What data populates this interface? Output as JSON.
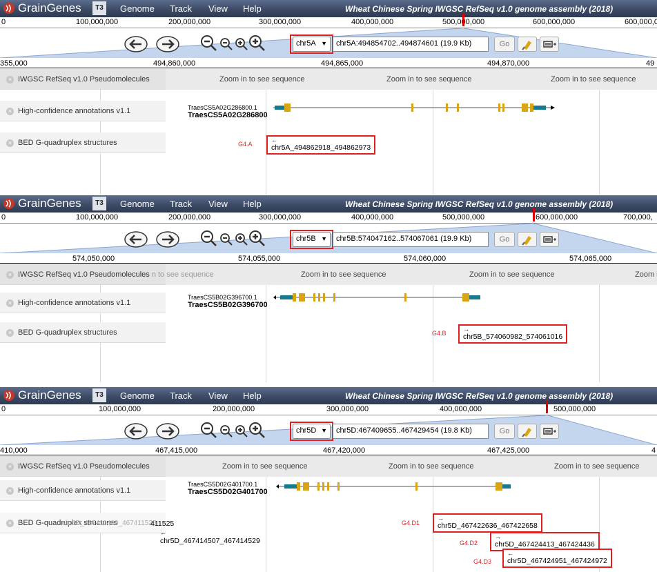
{
  "app": {
    "brand": "GrainGenes",
    "t3": "T3",
    "menu": [
      "Genome",
      "Track",
      "View",
      "Help"
    ],
    "assembly": "Wheat Chinese Spring IWGSC RefSeq v1.0 genome assembly (2018)"
  },
  "go_label": "Go",
  "zoom_message": "Zoom in to see sequence",
  "panels": [
    {
      "overview_ticks": [
        "0",
        "100,000,000",
        "200,000,000",
        "300,000,000",
        "400,000,000",
        "500,000,000",
        "600,000,000",
        "700,000"
      ],
      "chromosome": "chr5A",
      "location": "chr5A:494854702..494874601 (19.9 Kb)",
      "scale_ticks": [
        "355,000",
        "494,860,000",
        "494,865,000",
        "494,870,000",
        "49"
      ],
      "tracks": [
        "IWGSC RefSeq v1.0 Pseudomolecules",
        "High-confidence annotations v1.1",
        "BED G-quadruplex structures"
      ],
      "gene_transcript": "TraesCS5A02G286800.1",
      "gene_name": "TraesCS5A02G286800",
      "g4": [
        {
          "label": "G4.A",
          "feature": "chr5A_494862918_494862973",
          "strand": "←"
        }
      ]
    },
    {
      "overview_ticks": [
        "0",
        "100,000,000",
        "200,000,000",
        "300,000,000",
        "400,000,000",
        "500,000,000",
        "600,000,000",
        "700,000,"
      ],
      "chromosome": "chr5B",
      "location": "chr5B:574047162..574067061 (19.9 Kb)",
      "scale_ticks": [
        "574,050,000",
        "574,055,000",
        "574,060,000",
        "574,065,000"
      ],
      "tracks": [
        "IWGSC RefSeq v1.0 Pseudomolecules",
        "High-confidence annotations v1.1",
        "BED G-quadruplex structures"
      ],
      "track_overflow": "n to see sequence",
      "gene_transcript": "TraesCS5B02G396700.1",
      "gene_name": "TraesCS5B02G396700",
      "seq_partial": "Zoom i",
      "g4": [
        {
          "label": "G4.B",
          "feature": "chr5B_574060982_574061016",
          "strand": "→"
        }
      ]
    },
    {
      "overview_ticks": [
        "0",
        "100,000,000",
        "200,000,000",
        "300,000,000",
        "400,000,000",
        "500,000,000"
      ],
      "chromosome": "chr5D",
      "location": "chr5D:467409655..467429454 (19.8 Kb)",
      "scale_ticks": [
        "410,000",
        "467,415,000",
        "467,420,000",
        "467,425,000",
        "4"
      ],
      "tracks": [
        "IWGSC RefSeq v1.0 Pseudomolecules",
        "High-confidence annotations v1.1",
        "BED G-quadruplex structures"
      ],
      "gene_transcript": "TraesCS5D02G401700.1",
      "gene_name": "TraesCS5D02G401700",
      "ghost_label": "chr5D_467411499_467411525",
      "ghost_tail": "411525",
      "plain_feature": "chr5D_467414507_467414529",
      "g4": [
        {
          "label": "G4.D1",
          "feature": "chr5D_467422636_467422658",
          "strand": "→"
        },
        {
          "label": "G4.D2",
          "feature": "chr5D_467424413_467424436",
          "strand": "→"
        },
        {
          "label": "G4.D3",
          "feature": "chr5D_467424951_467424972",
          "strand": "←"
        }
      ]
    }
  ]
}
